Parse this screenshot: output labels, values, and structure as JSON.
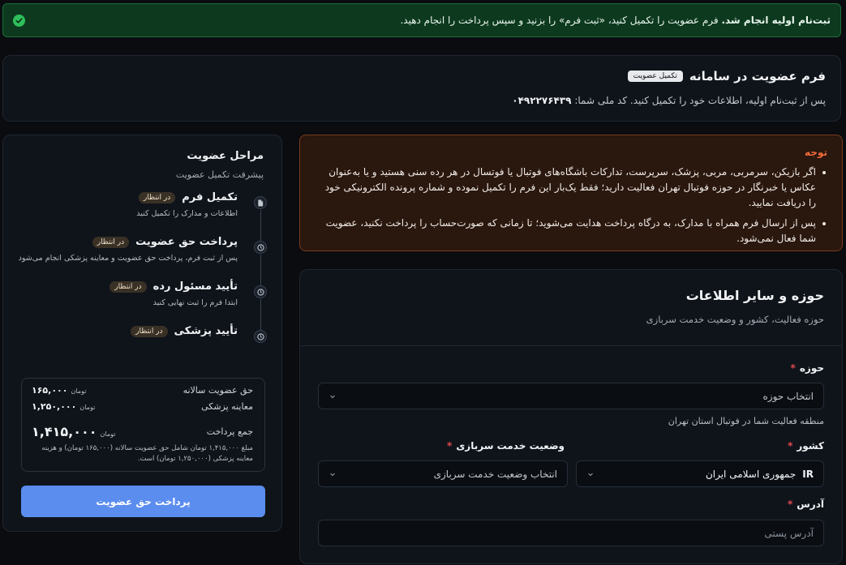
{
  "alert": {
    "bold": "ثبت‌نام اولیه انجام شد.",
    "text": " فرم عضویت را تکمیل کنید، «ثبت فرم» را بزنید و سپس پرداخت را انجام دهید."
  },
  "header": {
    "title": "فرم عضویت در سامانه",
    "badge": "تکمیل عضویت",
    "subtitle": "پس از ثبت‌نام اولیه، اطلاعات خود را تکمیل کنید. کد ملی شما:",
    "national_code": "۰۴۹۲۲۷۶۴۳۹"
  },
  "warning": {
    "title": "توجه",
    "items": [
      "اگر بازیکن، سرمربی، مربی، پزشک، سرپرست، تدارکات باشگاه‌های فوتبال یا فوتسال در هر رده سنی هستید و یا به‌عنوان عکاس یا خبرنگار در حوزه فوتبال تهران فعالیت دارید؛ فقط یک‌بار این فرم را تکمیل نموده و شماره پرونده الکترونیکی خود را دریافت نمایید.",
      "پس از ارسال فرم همراه با مدارک، به درگاه پرداخت هدایت می‌شوید؛ تا زمانی که صورت‌حساب را پرداخت نکنید، عضویت شما فعال نمی‌شود."
    ]
  },
  "steps": {
    "title": "مراحل عضویت",
    "subtitle": "پیشرفت تکمیل عضویت",
    "items": [
      {
        "name": "تکمیل فرم",
        "status": "در انتظار",
        "desc": "اطلاعات و مدارک را تکمیل کنید",
        "icon": "document-icon"
      },
      {
        "name": "پرداخت حق عضویت",
        "status": "در انتظار",
        "desc": "پس از ثبت فرم، پرداخت حق عضویت و معاینه پزشکی انجام می‌شود",
        "icon": "clock-icon"
      },
      {
        "name": "تأیید مسئول رده",
        "status": "در انتظار",
        "desc": "ابتدا فرم را ثبت نهایی کنید",
        "icon": "clock-icon"
      },
      {
        "name": "تأیید پزشکی",
        "status": "در انتظار",
        "desc": "",
        "icon": "clock-icon"
      }
    ]
  },
  "payment": {
    "annual_label": "حق عضویت سالانه",
    "annual_amount": "۱۶۵,۰۰۰",
    "medical_label": "معاینه پزشکی",
    "medical_amount": "۱,۲۵۰,۰۰۰",
    "currency": "تومان",
    "total_label": "جمع پرداخت",
    "total_amount": "۱,۴۱۵,۰۰۰",
    "note": "مبلغ ۱,۴۱۵,۰۰۰ تومان شامل حق عضویت سالانه (۱۶۵,۰۰۰ تومان) و هزینه معاینه پزشکی (۱,۲۵۰,۰۰۰ تومان) است.",
    "button": "پرداخت حق عضویت"
  },
  "form": {
    "title": "حوزه و سایر اطلاعات",
    "subtitle": "حوزه فعالیت، کشور و وضعیت خدمت سربازی",
    "zone_label": "حوزه",
    "zone_value": "انتخاب حوزه",
    "zone_hint": "منطقه فعالیت شما در فوتبال استان تهران",
    "country_label": "کشور",
    "country_code": "IR",
    "country_value": "جمهوری اسلامی ایران",
    "military_label": "وضعیت خدمت سربازی",
    "military_value": "انتخاب وضعیت خدمت سربازی",
    "address_label": "آدرس",
    "postal_placeholder": "آدرس پستی",
    "required_mark": "*"
  },
  "colors": {
    "accent": "#5b8def",
    "success": "#2fbf5b",
    "warning_title": "#f26a3a",
    "required": "#e5484d"
  }
}
